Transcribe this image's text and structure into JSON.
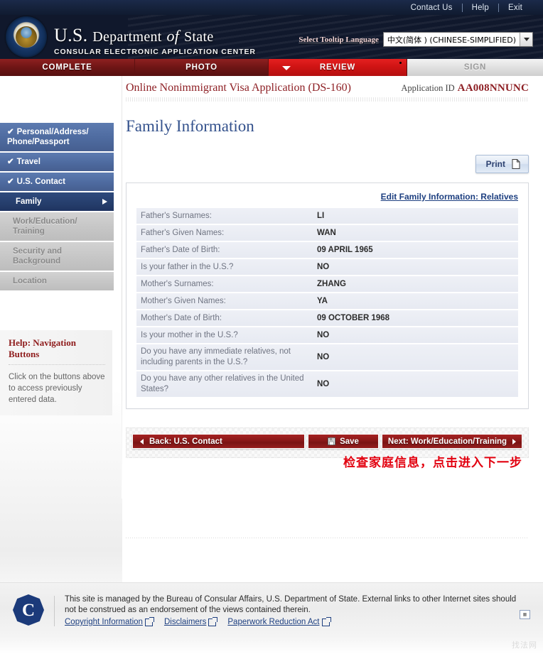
{
  "utility": {
    "links": [
      "Contact Us",
      "Help",
      "Exit"
    ]
  },
  "banner": {
    "title_us": "U.S.",
    "title_department": "Department",
    "title_of": "of",
    "title_state": "State",
    "subtitle": "CONSULAR ELECTRONIC APPLICATION CENTER",
    "language_label": "Select Tooltip Language",
    "language_value": "中文(简体 ) (CHINESE-SIMPLIFIED)"
  },
  "steps": [
    {
      "label": "COMPLETE",
      "state": "done"
    },
    {
      "label": "PHOTO",
      "state": "done"
    },
    {
      "label": "REVIEW",
      "state": "active"
    },
    {
      "label": "SIGN",
      "state": "disabled"
    }
  ],
  "sidebar": {
    "items": [
      {
        "label": "Personal/Address/ Phone/Passport",
        "state": "complete",
        "check": "✔"
      },
      {
        "label": "Travel",
        "state": "complete",
        "check": "✔"
      },
      {
        "label": "U.S. Contact",
        "state": "complete",
        "check": "✔"
      },
      {
        "label": "Family",
        "state": "active",
        "check": ""
      },
      {
        "label": "Work/Education/ Training",
        "state": "disabled",
        "check": ""
      },
      {
        "label": "Security and Background",
        "state": "disabled",
        "check": ""
      },
      {
        "label": "Location",
        "state": "disabled",
        "check": ""
      }
    ],
    "help": {
      "title": "Help: Navigation Buttons",
      "body": "Click on the buttons above to access previously entered data."
    }
  },
  "main": {
    "app_name": "Online Nonimmigrant Visa Application (DS-160)",
    "app_id_label": "Application ID",
    "app_id_value": "AA008NNUNC",
    "page_title": "Family Information",
    "print_label": "Print",
    "edit_link": "Edit Family Information: Relatives",
    "rows": [
      {
        "key": "Father's Surnames:",
        "value": "LI"
      },
      {
        "key": "Father's Given Names:",
        "value": "WAN"
      },
      {
        "key": "Father's Date of Birth:",
        "value": "09 APRIL 1965"
      },
      {
        "key": "Is your father in the U.S.?",
        "value": "NO"
      },
      {
        "key": "Mother's Surnames:",
        "value": "ZHANG"
      },
      {
        "key": "Mother's Given Names:",
        "value": "YA"
      },
      {
        "key": "Mother's Date of Birth:",
        "value": "09 OCTOBER 1968"
      },
      {
        "key": "Is your mother in the U.S.?",
        "value": "NO"
      },
      {
        "key": "Do you have any immediate relatives, not including parents in the U.S.?",
        "value": "NO"
      },
      {
        "key": "Do you have any other relatives in the United States?",
        "value": "NO"
      }
    ],
    "buttons": {
      "back": "Back: U.S. Contact",
      "save": "Save",
      "next": "Next: Work/Education/Training"
    },
    "annotation": "检查家庭信息，点击进入下一步"
  },
  "footer": {
    "seal_letter": "C",
    "text": "This site is managed by the Bureau of Consular Affairs, U.S. Department of State. External links to other Internet sites should not be construed as an endorsement of the views contained therein.",
    "links": [
      "Copyright Information",
      "Disclaimers",
      "Paperwork Reduction Act"
    ],
    "watermark": "找法网"
  }
}
